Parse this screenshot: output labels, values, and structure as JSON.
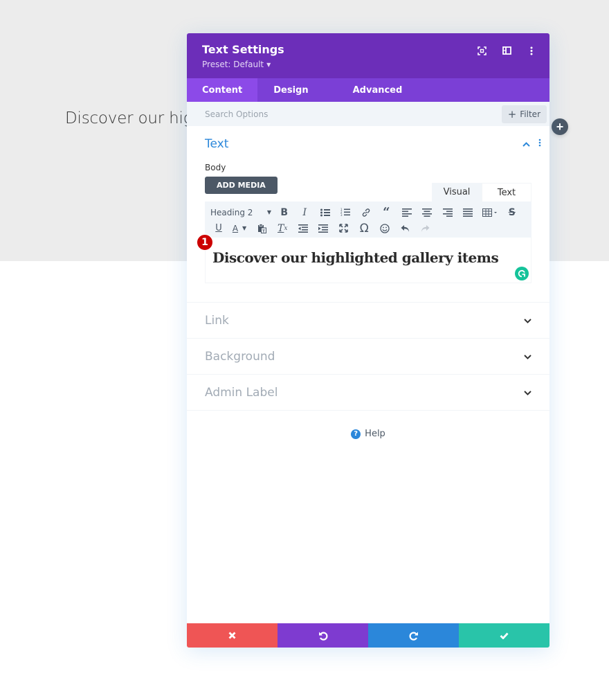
{
  "page": {
    "heading_text": "Discover our highlighted gallery items"
  },
  "modal": {
    "title": "Text Settings",
    "preset_label": "Preset: Default",
    "header_icons": [
      "focus-mode-icon",
      "split-view-icon",
      "more-options-icon"
    ],
    "tabs": [
      {
        "label": "Content",
        "active": true
      },
      {
        "label": "Design",
        "active": false
      },
      {
        "label": "Advanced",
        "active": false
      }
    ],
    "search": {
      "placeholder": "Search Options",
      "value": ""
    },
    "filter_label": "Filter",
    "sections": {
      "text": {
        "title": "Text",
        "body_label": "Body",
        "add_media_label": "ADD MEDIA",
        "editor_tabs": [
          {
            "label": "Visual",
            "active": true
          },
          {
            "label": "Text",
            "active": false
          }
        ],
        "toolbar": {
          "format_select": "Heading 2",
          "row1": [
            "bold",
            "italic",
            "bullet-list",
            "numbered-list",
            "link",
            "blockquote",
            "align-left",
            "align-center",
            "align-right",
            "align-justify",
            "table",
            "strikethrough"
          ],
          "row2": [
            "underline",
            "text-color",
            "paste-as-text",
            "clear-formatting",
            "outdent",
            "indent",
            "fullscreen",
            "special-character",
            "emoji",
            "undo",
            "redo"
          ]
        },
        "content": "Discover our highlighted gallery items",
        "step_badge": "1"
      },
      "collapsed": [
        {
          "title": "Link"
        },
        {
          "title": "Background"
        },
        {
          "title": "Admin Label"
        }
      ]
    },
    "help_label": "Help",
    "footer": {
      "buttons": [
        {
          "name": "cancel",
          "icon": "close-icon",
          "color": "#ef5555"
        },
        {
          "name": "undo",
          "icon": "undo-icon",
          "color": "#7e3bd0"
        },
        {
          "name": "redo",
          "icon": "redo-icon",
          "color": "#2b87da"
        },
        {
          "name": "save",
          "icon": "check-icon",
          "color": "#29c4a9"
        }
      ]
    }
  },
  "colors": {
    "header_bg": "#6c2eb9",
    "tabs_bg": "#7b3fd6",
    "active_tab_bg": "#8c4ae8",
    "accent_blue": "#2b87da",
    "badge_red": "#cc0000"
  }
}
